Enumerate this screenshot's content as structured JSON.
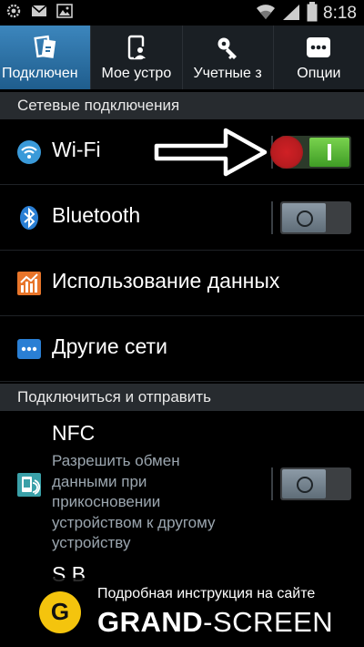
{
  "status_bar": {
    "left_icons": [
      "settings-icon",
      "mail-icon",
      "image-icon"
    ],
    "right_icons": [
      "wifi-signal-icon",
      "cellular-signal-icon",
      "battery-icon"
    ],
    "time": "8:18"
  },
  "tabs": [
    {
      "label": "Подключен",
      "icon": "connections-icon",
      "active": true
    },
    {
      "label": "Мое устро",
      "icon": "device-icon",
      "active": false
    },
    {
      "label": "Учетные з",
      "icon": "key-icon",
      "active": false
    },
    {
      "label": "Опции",
      "icon": "more-icon",
      "active": false
    }
  ],
  "sections": {
    "network": "Сетевые подключения",
    "connect_share": "Подключиться и отправить"
  },
  "rows": {
    "wifi": {
      "label": "Wi-Fi",
      "icon": "wifi-icon",
      "state": "on"
    },
    "bluetooth": {
      "label": "Bluetooth",
      "icon": "bluetooth-icon",
      "state": "off"
    },
    "data_usage": {
      "label": "Использование данных",
      "icon": "data-usage-icon"
    },
    "other_networks": {
      "label": "Другие сети",
      "icon": "more-networks-icon"
    }
  },
  "nfc": {
    "title": "NFC",
    "description_lines": [
      "Разрешить обмен",
      "данными при",
      "прикосновении",
      "устройством к другому",
      "устройству"
    ],
    "state": "off",
    "icon": "nfc-icon"
  },
  "partial_row": "S B",
  "banner": {
    "top_text": "Подробная инструкция на сайте",
    "brand_bold": "GRAND",
    "brand_rest": "-SCREEN",
    "logo_letter": "G"
  },
  "colors": {
    "active_tab": "#3c86bd",
    "switch_on": "#5cbf36",
    "wifi_blue": "#3a9ad9",
    "red_marker": "#d02025",
    "logo_yellow": "#f4c40d"
  }
}
